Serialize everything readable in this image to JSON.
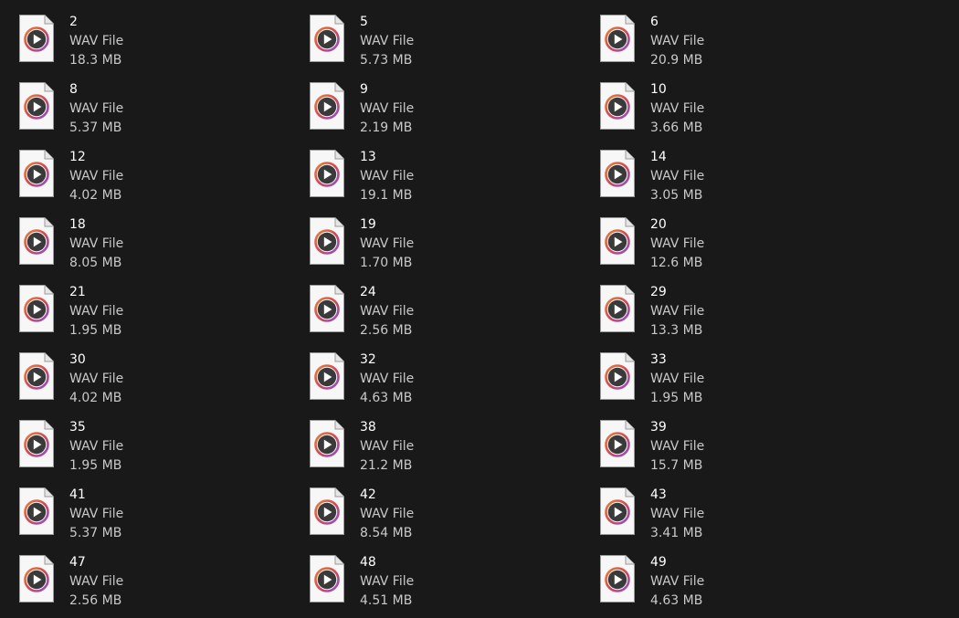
{
  "view": {
    "files": [
      {
        "name": "2",
        "type": "WAV File",
        "size": "18.3 MB",
        "icon": "wav-file-icon"
      },
      {
        "name": "5",
        "type": "WAV File",
        "size": "5.73 MB",
        "icon": "wav-file-icon"
      },
      {
        "name": "6",
        "type": "WAV File",
        "size": "20.9 MB",
        "icon": "wav-file-icon"
      },
      {
        "name": "8",
        "type": "WAV File",
        "size": "5.37 MB",
        "icon": "wav-file-icon"
      },
      {
        "name": "9",
        "type": "WAV File",
        "size": "2.19 MB",
        "icon": "wav-file-icon"
      },
      {
        "name": "10",
        "type": "WAV File",
        "size": "3.66 MB",
        "icon": "wav-file-icon"
      },
      {
        "name": "12",
        "type": "WAV File",
        "size": "4.02 MB",
        "icon": "wav-file-icon"
      },
      {
        "name": "13",
        "type": "WAV File",
        "size": "19.1 MB",
        "icon": "wav-file-icon"
      },
      {
        "name": "14",
        "type": "WAV File",
        "size": "3.05 MB",
        "icon": "wav-file-icon"
      },
      {
        "name": "18",
        "type": "WAV File",
        "size": "8.05 MB",
        "icon": "wav-file-icon"
      },
      {
        "name": "19",
        "type": "WAV File",
        "size": "1.70 MB",
        "icon": "wav-file-icon"
      },
      {
        "name": "20",
        "type": "WAV File",
        "size": "12.6 MB",
        "icon": "wav-file-icon"
      },
      {
        "name": "21",
        "type": "WAV File",
        "size": "1.95 MB",
        "icon": "wav-file-icon"
      },
      {
        "name": "24",
        "type": "WAV File",
        "size": "2.56 MB",
        "icon": "wav-file-icon"
      },
      {
        "name": "29",
        "type": "WAV File",
        "size": "13.3 MB",
        "icon": "wav-file-icon"
      },
      {
        "name": "30",
        "type": "WAV File",
        "size": "4.02 MB",
        "icon": "wav-file-icon"
      },
      {
        "name": "32",
        "type": "WAV File",
        "size": "4.63 MB",
        "icon": "wav-file-icon"
      },
      {
        "name": "33",
        "type": "WAV File",
        "size": "1.95 MB",
        "icon": "wav-file-icon"
      },
      {
        "name": "35",
        "type": "WAV File",
        "size": "1.95 MB",
        "icon": "wav-file-icon"
      },
      {
        "name": "38",
        "type": "WAV File",
        "size": "21.2 MB",
        "icon": "wav-file-icon"
      },
      {
        "name": "39",
        "type": "WAV File",
        "size": "15.7 MB",
        "icon": "wav-file-icon"
      },
      {
        "name": "41",
        "type": "WAV File",
        "size": "5.37 MB",
        "icon": "wav-file-icon"
      },
      {
        "name": "42",
        "type": "WAV File",
        "size": "8.54 MB",
        "icon": "wav-file-icon"
      },
      {
        "name": "43",
        "type": "WAV File",
        "size": "3.41 MB",
        "icon": "wav-file-icon"
      },
      {
        "name": "47",
        "type": "WAV File",
        "size": "2.56 MB",
        "icon": "wav-file-icon"
      },
      {
        "name": "48",
        "type": "WAV File",
        "size": "4.51 MB",
        "icon": "wav-file-icon"
      },
      {
        "name": "49",
        "type": "WAV File",
        "size": "4.63 MB",
        "icon": "wav-file-icon"
      }
    ]
  },
  "colors": {
    "background": "#191919",
    "text_primary": "#ffffff",
    "text_secondary": "#c9c9c9",
    "icon_ring_start": "#e8823a",
    "icon_ring_mid": "#d8454f",
    "icon_ring_end": "#8a4fd4"
  }
}
